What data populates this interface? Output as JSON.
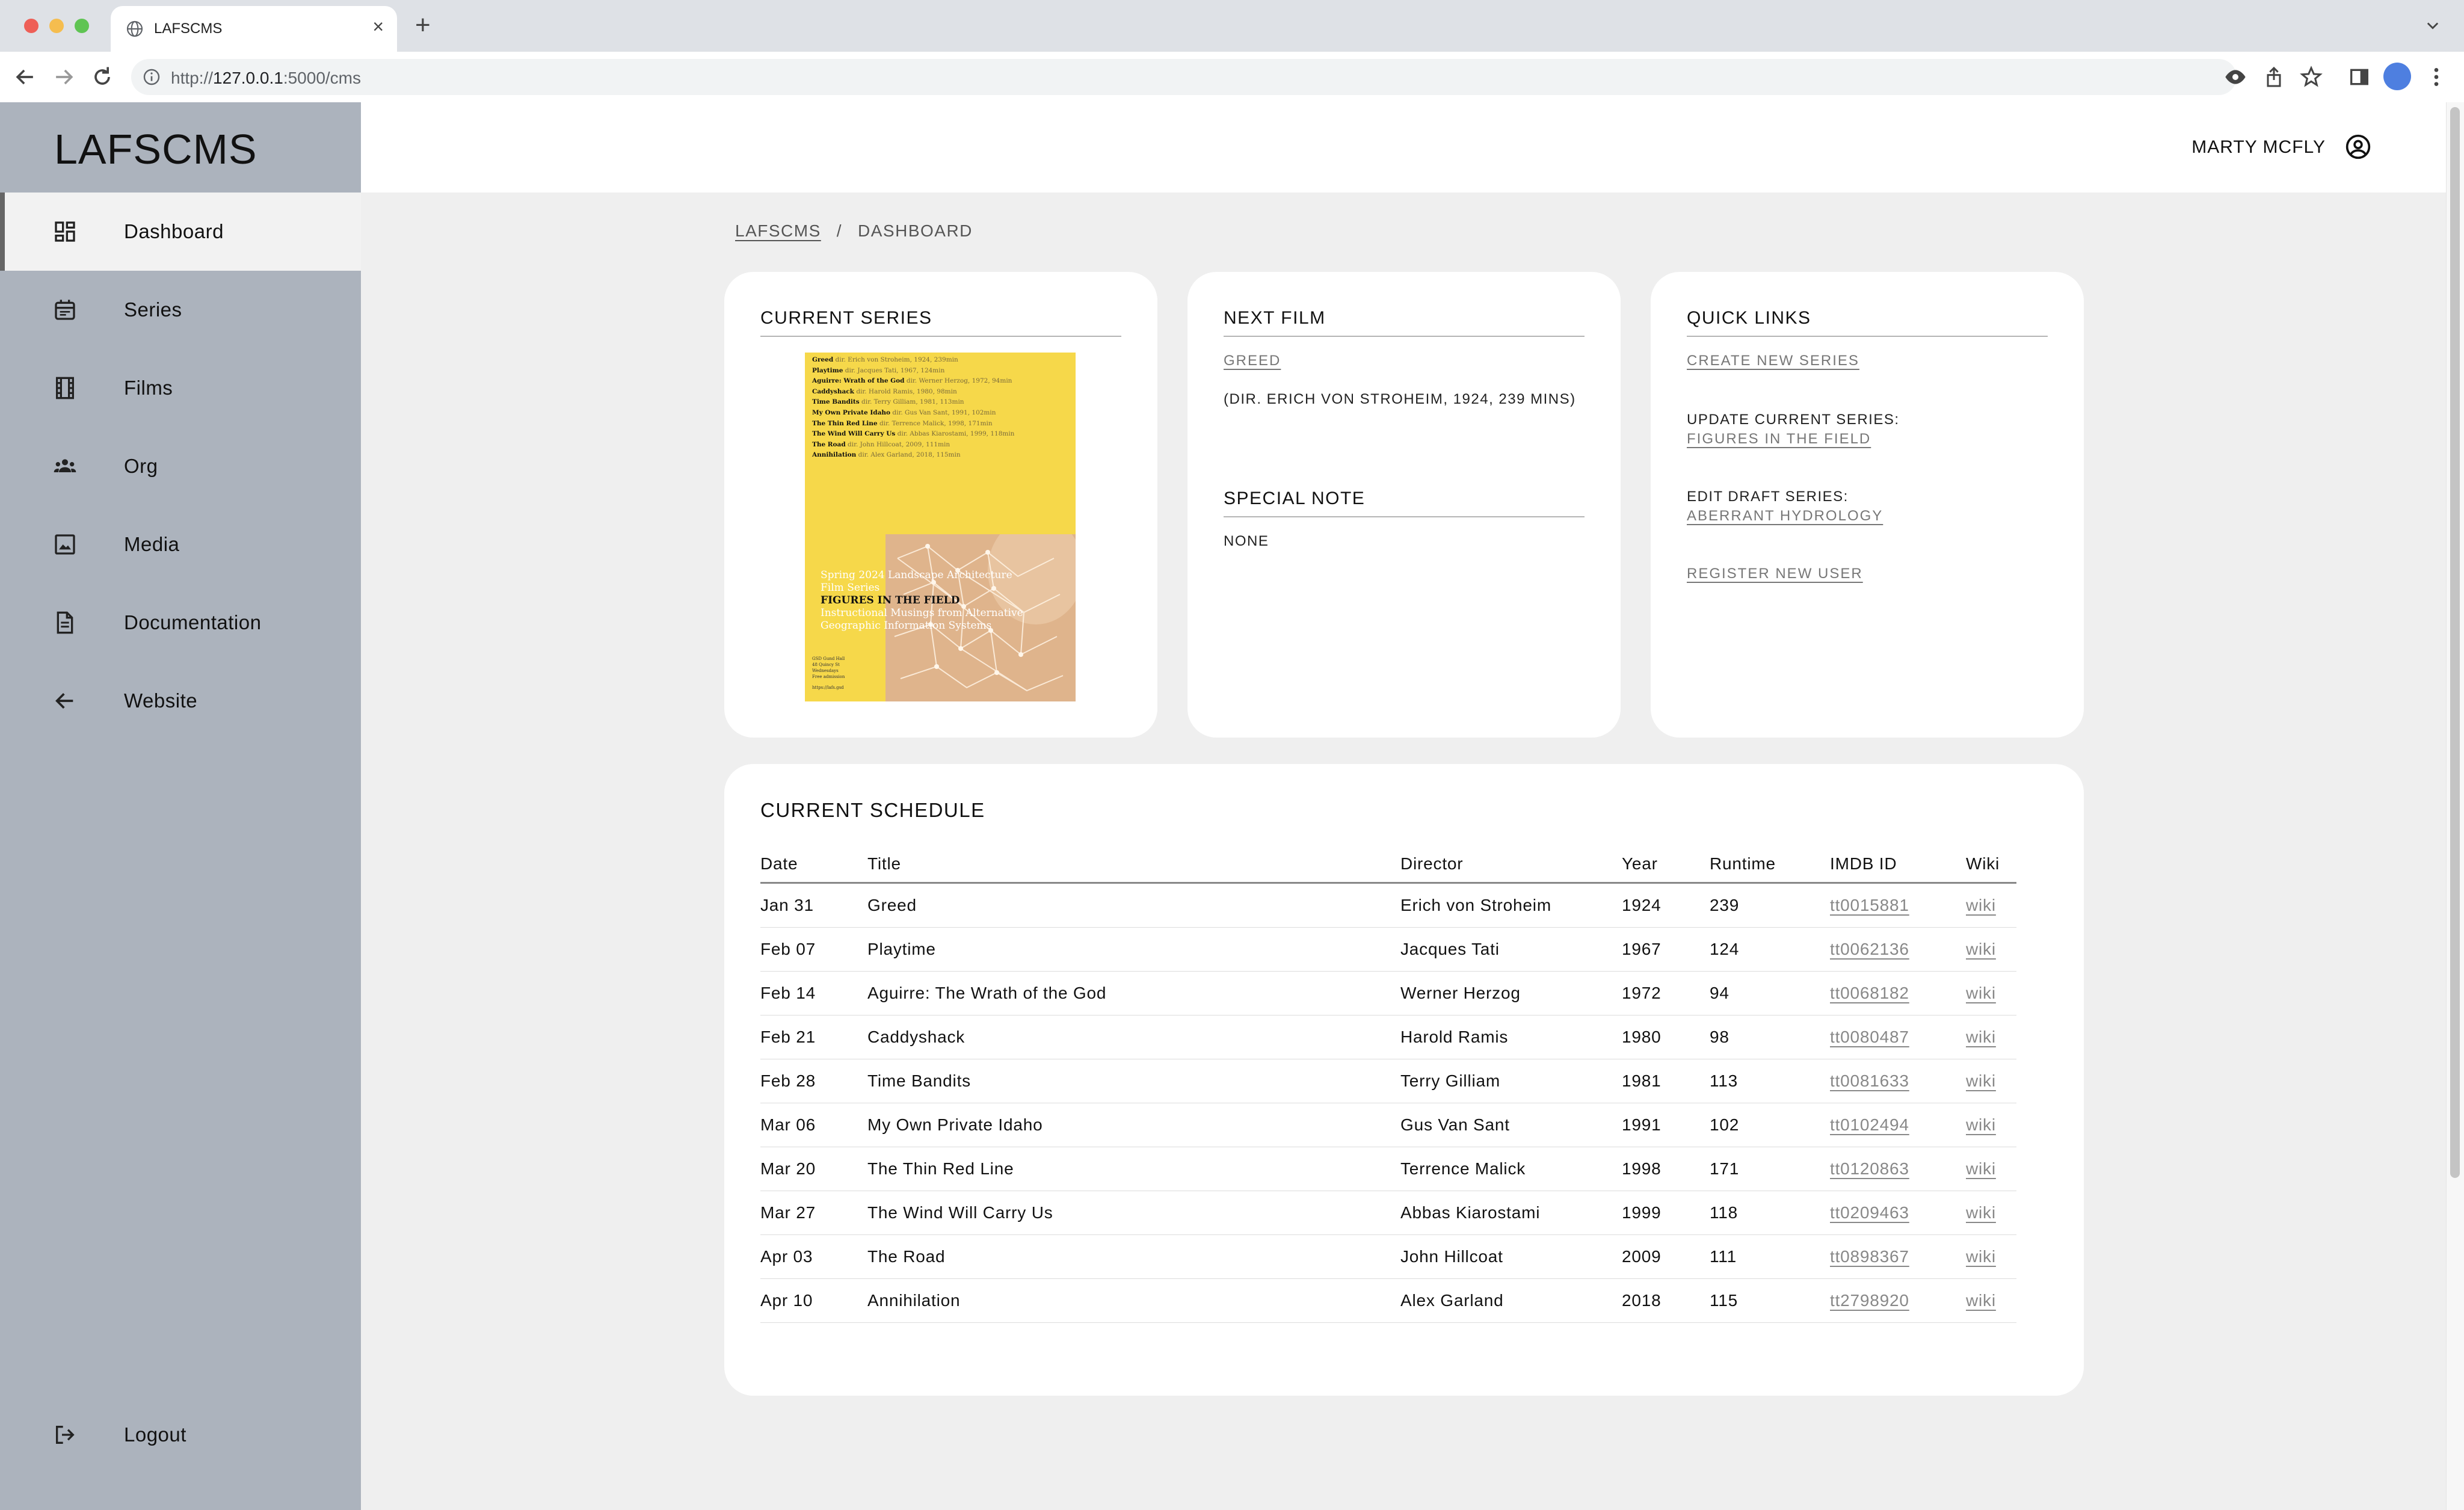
{
  "browser": {
    "tab_title": "LAFSCMS",
    "url_prefix": "http://",
    "url_host": "127.0.0.1",
    "url_path": ":5000/cms"
  },
  "app": {
    "brand": "LAFSCMS",
    "user": "MARTY MCFLY"
  },
  "sidebar": {
    "items": [
      {
        "label": "Dashboard",
        "icon": "dashboard-icon",
        "active": true
      },
      {
        "label": "Series",
        "icon": "calendar-icon"
      },
      {
        "label": "Films",
        "icon": "film-icon"
      },
      {
        "label": "Org",
        "icon": "group-icon"
      },
      {
        "label": "Media",
        "icon": "image-icon"
      },
      {
        "label": "Documentation",
        "icon": "document-icon"
      },
      {
        "label": "Website",
        "icon": "arrow-left-icon"
      }
    ],
    "logout": "Logout"
  },
  "breadcrumb": {
    "root": "LAFSCMS",
    "separator": "/",
    "current": "DASHBOARD"
  },
  "current_series": {
    "title": "CURRENT SERIES",
    "poster": {
      "films": [
        {
          "title": "Greed",
          "meta": "dir. Erich von Stroheim, 1924, 239min"
        },
        {
          "title": "Playtime",
          "meta": "dir. Jacques Tati, 1967, 124min"
        },
        {
          "title": "Aguirre: Wrath of the God",
          "meta": "dir. Werner Herzog, 1972, 94min"
        },
        {
          "title": "Caddyshack",
          "meta": "dir. Harold Ramis, 1980, 98min"
        },
        {
          "title": "Time Bandits",
          "meta": "dir. Terry Gilliam, 1981, 113min"
        },
        {
          "title": "My Own Private Idaho",
          "meta": "dir. Gus Van Sant, 1991, 102min"
        },
        {
          "title": "The Thin Red Line",
          "meta": "dir. Terrence Malick, 1998, 171min"
        },
        {
          "title": "The Wind Will Carry Us",
          "meta": "dir. Abbas Kiarostami, 1999, 118min"
        },
        {
          "title": "The Road",
          "meta": "dir. John Hillcoat, 2009, 111min"
        },
        {
          "title": "Annihilation",
          "meta": "dir. Alex Garland, 2018, 115min"
        }
      ],
      "headline_1": "Spring 2024 Landscape Architecture",
      "headline_2": "Film Series",
      "headline_3": "FIGURES IN THE FIELD",
      "headline_4": "Instructional Musings from Alternative",
      "headline_5": "Geographic Information Systems",
      "footer_1": "GSD Gund Hall",
      "footer_2": "48 Quincy St",
      "footer_3": "Wednesdays",
      "footer_4": "Free admission",
      "footer_5": "https://lafs.gsd"
    }
  },
  "next_film": {
    "title": "NEXT FILM",
    "film_link": "GREED",
    "details": "(DIR. ERICH VON STROHEIM, 1924, 239 MINS)",
    "note_title": "SPECIAL NOTE",
    "note": "NONE"
  },
  "quick_links": {
    "title": "QUICK LINKS",
    "create_series": "CREATE NEW SERIES",
    "update_label": "UPDATE CURRENT SERIES:",
    "update_link": "FIGURES IN THE FIELD",
    "draft_label": "EDIT DRAFT SERIES:",
    "draft_link": "ABERRANT HYDROLOGY",
    "register_user": "REGISTER NEW USER"
  },
  "schedule": {
    "title": "CURRENT SCHEDULE",
    "columns": [
      "Date",
      "Title",
      "Director",
      "Year",
      "Runtime",
      "IMDB ID",
      "Wiki"
    ],
    "rows": [
      {
        "date": "Jan 31",
        "title": "Greed",
        "director": "Erich von Stroheim",
        "year": "1924",
        "runtime": "239",
        "imdb": "tt0015881",
        "wiki": "wiki"
      },
      {
        "date": "Feb 07",
        "title": "Playtime",
        "director": "Jacques Tati",
        "year": "1967",
        "runtime": "124",
        "imdb": "tt0062136",
        "wiki": "wiki"
      },
      {
        "date": "Feb 14",
        "title": "Aguirre: The Wrath of the God",
        "director": "Werner Herzog",
        "year": "1972",
        "runtime": "94",
        "imdb": "tt0068182",
        "wiki": "wiki"
      },
      {
        "date": "Feb 21",
        "title": "Caddyshack",
        "director": "Harold Ramis",
        "year": "1980",
        "runtime": "98",
        "imdb": "tt0080487",
        "wiki": "wiki"
      },
      {
        "date": "Feb 28",
        "title": "Time Bandits",
        "director": "Terry Gilliam",
        "year": "1981",
        "runtime": "113",
        "imdb": "tt0081633",
        "wiki": "wiki"
      },
      {
        "date": "Mar 06",
        "title": "My Own Private Idaho",
        "director": "Gus Van Sant",
        "year": "1991",
        "runtime": "102",
        "imdb": "tt0102494",
        "wiki": "wiki"
      },
      {
        "date": "Mar 20",
        "title": "The Thin Red Line",
        "director": "Terrence Malick",
        "year": "1998",
        "runtime": "171",
        "imdb": "tt0120863",
        "wiki": "wiki"
      },
      {
        "date": "Mar 27",
        "title": "The Wind Will Carry Us",
        "director": "Abbas Kiarostami",
        "year": "1999",
        "runtime": "118",
        "imdb": "tt0209463",
        "wiki": "wiki"
      },
      {
        "date": "Apr 03",
        "title": "The Road",
        "director": "John Hillcoat",
        "year": "2009",
        "runtime": "111",
        "imdb": "tt0898367",
        "wiki": "wiki"
      },
      {
        "date": "Apr 10",
        "title": "Annihilation",
        "director": "Alex Garland",
        "year": "2018",
        "runtime": "115",
        "imdb": "tt2798920",
        "wiki": "wiki"
      }
    ]
  },
  "colors": {
    "sidebar_bg": "#acb3bd",
    "content_bg": "#efefef",
    "card_bg": "#ffffff",
    "poster_yellow": "#f6d84a",
    "link_gray": "#777777"
  }
}
